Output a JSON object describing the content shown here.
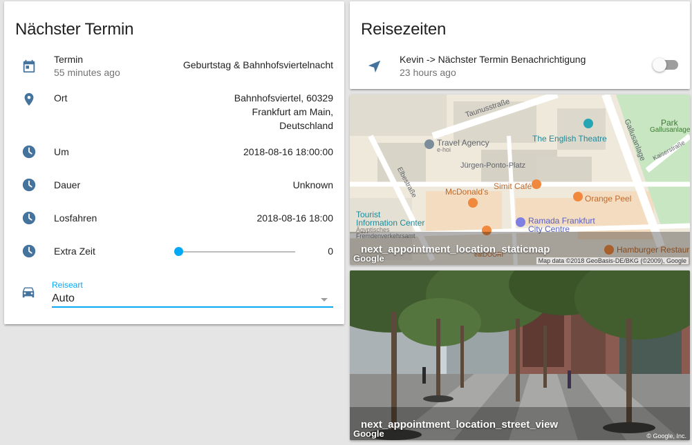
{
  "colors": {
    "icon": "#44739e",
    "accent": "#03a9f4",
    "secondary_text": "#727272"
  },
  "appointment_card": {
    "title": "Nächster Termin",
    "rows": [
      {
        "icon": "calendar-icon",
        "label": "Termin",
        "sublabel": "55 minutes ago",
        "value": "Geburtstag & Bahnhofsviertelnacht"
      },
      {
        "icon": "map-marker-icon",
        "label": "Ort",
        "value_lines": [
          "Bahnhofsviertel, 60329",
          "Frankfurt am Main,",
          "Deutschland"
        ]
      },
      {
        "icon": "clock-icon",
        "label": "Um",
        "value": "2018-08-16 18:00:00"
      },
      {
        "icon": "clock-icon",
        "label": "Dauer",
        "value": "Unknown"
      },
      {
        "icon": "clock-icon",
        "label": "Losfahren",
        "value": "2018-08-16 18:00"
      },
      {
        "icon": "clock-icon",
        "label": "Extra Zeit",
        "value": "0",
        "slider_fraction": 0
      }
    ],
    "select": {
      "icon": "car-icon",
      "label": "Reiseart",
      "value": "Auto"
    }
  },
  "travel_card": {
    "title": "Reisezeiten",
    "row": {
      "icon": "send-icon",
      "label": "Kevin -> Nächster Termin Benachrichtigung",
      "sublabel": "23 hours ago",
      "toggle_on": false
    }
  },
  "map_camera": {
    "caption": "next_appointment_location_staticmap",
    "google_mark": "Google",
    "attribution": "Map data ©2018 GeoBasis-DE/BKG (©2009), Google",
    "labels": {
      "taunusstrasse": "Taunusstraße",
      "gallusanlage": "Gallusanlage",
      "park": "Park",
      "park_sub": "Gallusanlage",
      "kaiserstrasse": "Kaiserstraße",
      "english_theatre": "The English Theatre",
      "travel_agency": "Travel Agency",
      "travel_agency_sub": "e-hoi",
      "juergen_ponto": "Jürgen-Ponto-Platz",
      "elbestrasse": "Elbestraße",
      "mcdonalds": "McDonald's",
      "simit_cafe": "Simit Café",
      "orange_peel": "Orange Peel",
      "tourist_info_1": "Tourist",
      "tourist_info_2": "Information Center",
      "tourist_info_3": "Ägyptisches",
      "tourist_info_4": "Fremdenverkehrsamt",
      "ramada_1": "Ramada Frankfurt",
      "ramada_2": "City Centre",
      "hamburger": "Hamburger Restaura",
      "eatdoori": "eatDOORI"
    }
  },
  "street_camera": {
    "caption": "next_appointment_location_street_view",
    "google_mark": "Google",
    "attribution": "© Google, Inc."
  }
}
